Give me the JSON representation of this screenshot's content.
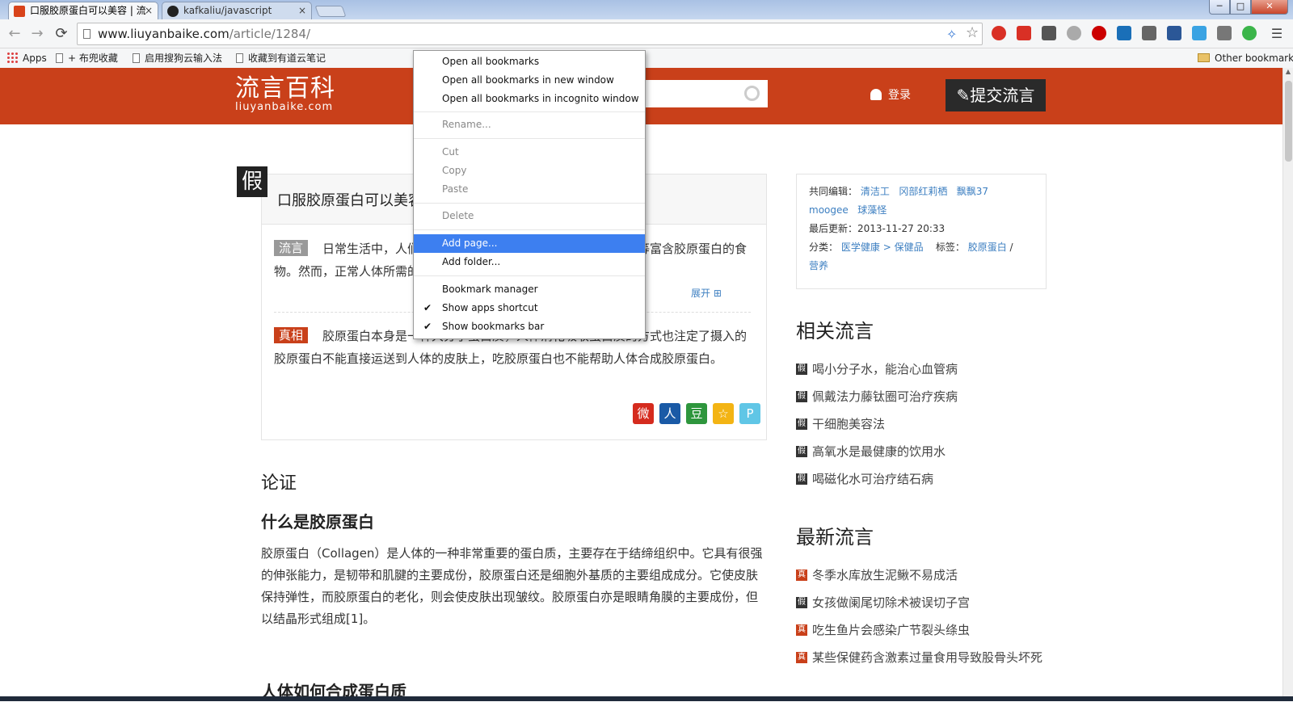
{
  "browser": {
    "tabs": [
      {
        "title": "口服胶原蛋白可以美容 | 流",
        "close": "×"
      },
      {
        "title": "kafkaliu/javascript",
        "close": "×"
      }
    ],
    "window_buttons": {
      "minimize": "─",
      "maximize": "□",
      "close": "✕"
    },
    "nav": {
      "back": "←",
      "forward": "→",
      "reload": "⟳"
    },
    "url_host": "www.liuyanbaike.com",
    "url_path": "/article/1284/",
    "bookmarks": [
      {
        "label": "Apps"
      },
      {
        "label": "+ 布兜收藏"
      },
      {
        "label": "启用搜狗云输入法"
      },
      {
        "label": "收藏到有道云笔记"
      }
    ],
    "other_bookmarks": "Other bookmarks"
  },
  "context_menu": {
    "items": [
      {
        "label": "Open all bookmarks"
      },
      {
        "label": "Open all bookmarks in new window"
      },
      {
        "label": "Open all bookmarks in incognito window"
      },
      {
        "label": "Rename..."
      },
      {
        "label": "Cut"
      },
      {
        "label": "Copy"
      },
      {
        "label": "Paste"
      },
      {
        "label": "Delete"
      },
      {
        "label": "Add page..."
      },
      {
        "label": "Add folder..."
      },
      {
        "label": "Bookmark manager"
      },
      {
        "label": "Show apps shortcut",
        "checked": true
      },
      {
        "label": "Show bookmarks bar",
        "checked": true
      }
    ],
    "check_glyph": "✔"
  },
  "site": {
    "logo_cn": "流言百科",
    "logo_en": "liuyanbaike.com",
    "login": "登录",
    "submit": "提交流言",
    "accent": "#c9401a"
  },
  "article": {
    "badge": "假",
    "title": "口服胶原蛋白可以美容",
    "rumor_tag": "流言",
    "rumor_text": "日常生活中，人们常说胶原蛋白能美容，猪蹄、鸡爪、猪皮等富含胶原蛋白的食物。然而，正常人体所需的胶原蛋白通过饮食中得到满足，需要通",
    "expand": "展开",
    "truth_tag": "真相",
    "truth_text": "胶原蛋白本身是一种大分子蛋白质，人体消化吸收蛋白质的方式也注定了摄入的胶原蛋白不能直接运送到人体的皮肤上，吃胶原蛋白也不能帮助人体合成胶原蛋白。",
    "share": [
      "微",
      "人",
      "豆",
      "☆",
      "P"
    ],
    "section": "论证",
    "h3_1": "什么是胶原蛋白",
    "body": "胶原蛋白（Collagen）是人体的一种非常重要的蛋白质，主要存在于结缔组织中。它具有很强的伸张能力，是韧带和肌腱的主要成份，胶原蛋白还是细胞外基质的主要组成成分。它使皮肤保持弹性，而胶原蛋白的老化，则会使皮肤出现皱纹。胶原蛋白亦是眼睛角膜的主要成份，但以结晶形式组成[1]。",
    "h3_2": "人体如何合成蛋白质"
  },
  "sidebar": {
    "editors_label": "共同编辑：",
    "editors": [
      "清洁工",
      "冈部红莉栖",
      "飘飘37",
      "moogee",
      "球藻怪"
    ],
    "updated_label": "最后更新：",
    "updated": "2013-11-27 20:33",
    "category_label": "分类：",
    "category": "医学健康",
    "subcategory": "保健品",
    "sep": ">",
    "tags_label": "标签：",
    "tags": [
      "胶原蛋白",
      "营养"
    ],
    "tag_sep": "/",
    "related_title": "相关流言",
    "related": [
      {
        "mark": "假",
        "text": "喝小分子水，能治心血管病"
      },
      {
        "mark": "假",
        "text": "佩戴法力藤钛圈可治疗疾病"
      },
      {
        "mark": "假",
        "text": "干细胞美容法"
      },
      {
        "mark": "假",
        "text": "高氧水是最健康的饮用水"
      },
      {
        "mark": "假",
        "text": "喝磁化水可治疗结石病"
      }
    ],
    "latest_title": "最新流言",
    "latest": [
      {
        "mark": "真",
        "text": "冬季水库放生泥鳅不易成活"
      },
      {
        "mark": "假",
        "text": "女孩做阑尾切除术被误切子宫"
      },
      {
        "mark": "真",
        "text": "吃生鱼片会感染广节裂头绦虫"
      },
      {
        "mark": "真",
        "text": "某些保健药含激素过量食用导致股骨头坏死"
      }
    ]
  }
}
